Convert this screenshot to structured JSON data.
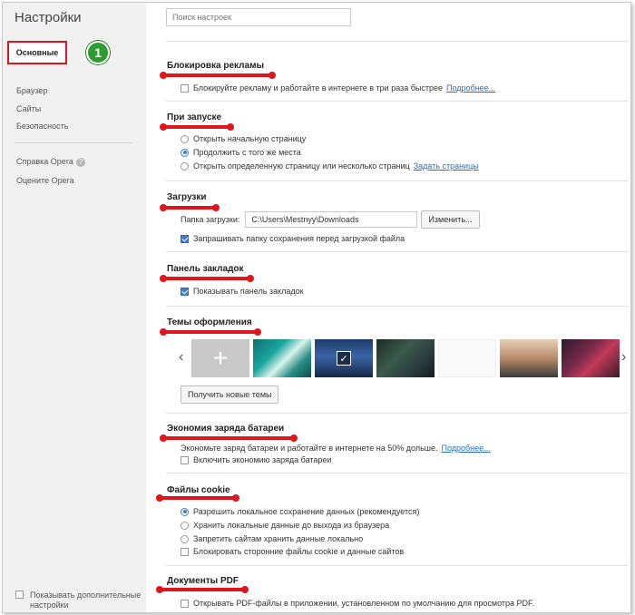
{
  "sidebar": {
    "title": "Настройки",
    "active_item": "Основные",
    "step_number": "1",
    "items": [
      {
        "label": "Браузер"
      },
      {
        "label": "Сайты"
      },
      {
        "label": "Безопасность"
      }
    ],
    "help": "Справка Opera",
    "rate": "Оцените Opera",
    "advanced": "Показывать дополнительные настройки"
  },
  "search": {
    "placeholder": "Поиск настроек"
  },
  "adblock": {
    "title": "Блокировка рекламы",
    "option": "Блокируйте рекламу и работайте в интернете в три раза быстрее",
    "link": "Подробнее..."
  },
  "startup": {
    "title": "При запуске",
    "options": [
      "Открыть начальную страницу",
      "Продолжить с того же места",
      "Открыть определенную страницу или несколько страниц"
    ],
    "link": "Задать страницы"
  },
  "downloads": {
    "title": "Загрузки",
    "folder_label": "Папка загрузки:",
    "folder_value": "C:\\Users\\Mestnyy\\Downloads",
    "change_button": "Изменить...",
    "ask_option": "Запрашивать папку сохранения перед загрузкой файла"
  },
  "bookmarks": {
    "title": "Панель закладок",
    "option": "Показывать панель закладок"
  },
  "themes": {
    "title": "Темы оформления",
    "get_button": "Получить новые темы",
    "colors": {
      "placeholder": "#c9c9c9",
      "accent": "#e0141b"
    }
  },
  "battery": {
    "title": "Экономия заряда батареи",
    "description": "Экономьте заряд батареи и работайте в интернете на 50% дольше.",
    "link": "Подробнее...",
    "option": "Включить экономию заряда батареи"
  },
  "cookies": {
    "title": "Файлы cookie",
    "options": [
      "Разрешить локальное сохранение данных (рекомендуется)",
      "Хранить локальные данные до выхода из браузера",
      "Запретить сайтам хранить данные локально"
    ],
    "block_third_party": "Блокировать сторонние файлы cookie и данные сайтов"
  },
  "pdf": {
    "title": "Документы PDF",
    "option": "Открывать PDF-файлы в приложении, установленном по умолчанию для просмотра PDF."
  }
}
